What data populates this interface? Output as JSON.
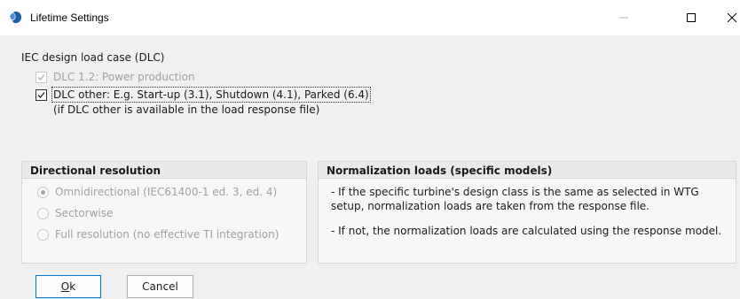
{
  "window": {
    "title": "Lifetime Settings",
    "icon": "app-globe-icon",
    "controls": [
      "minimize-icon",
      "maximize-icon",
      "close-icon"
    ]
  },
  "dlc": {
    "label": "IEC design load case (DLC)",
    "options": [
      {
        "label": "DLC 1.2: Power production",
        "checked": true,
        "enabled": false
      },
      {
        "label": "DLC other: E.g. Start-up (3.1), Shutdown (4.1), Parked (6.4)",
        "checked": true,
        "enabled": true,
        "focused": true
      }
    ],
    "sub_note": "(if DLC other is available in the load response file)"
  },
  "directional": {
    "header": "Directional resolution",
    "options": [
      {
        "label": "Omnidirectional (IEC61400-1 ed. 3, ed. 4)",
        "selected": true,
        "enabled": false
      },
      {
        "label": "Sectorwise",
        "selected": false,
        "enabled": false
      },
      {
        "label": "Full resolution (no effective TI integration)",
        "selected": false,
        "enabled": false
      }
    ]
  },
  "normalization": {
    "header": "Normalization loads (specific models)",
    "note1": "- If the specific turbine's design class is the same as selected in WTG setup, normalization loads are taken from the response file.",
    "note2": "- If not, the normalization loads are calculated using the response model."
  },
  "buttons": {
    "ok_mnemonic": "O",
    "ok_rest": "k",
    "cancel": "Cancel"
  },
  "colors": {
    "accent": "#0078d7",
    "icon_blue": "#1f5fa8",
    "disabled_text": "#a0a0a0"
  }
}
